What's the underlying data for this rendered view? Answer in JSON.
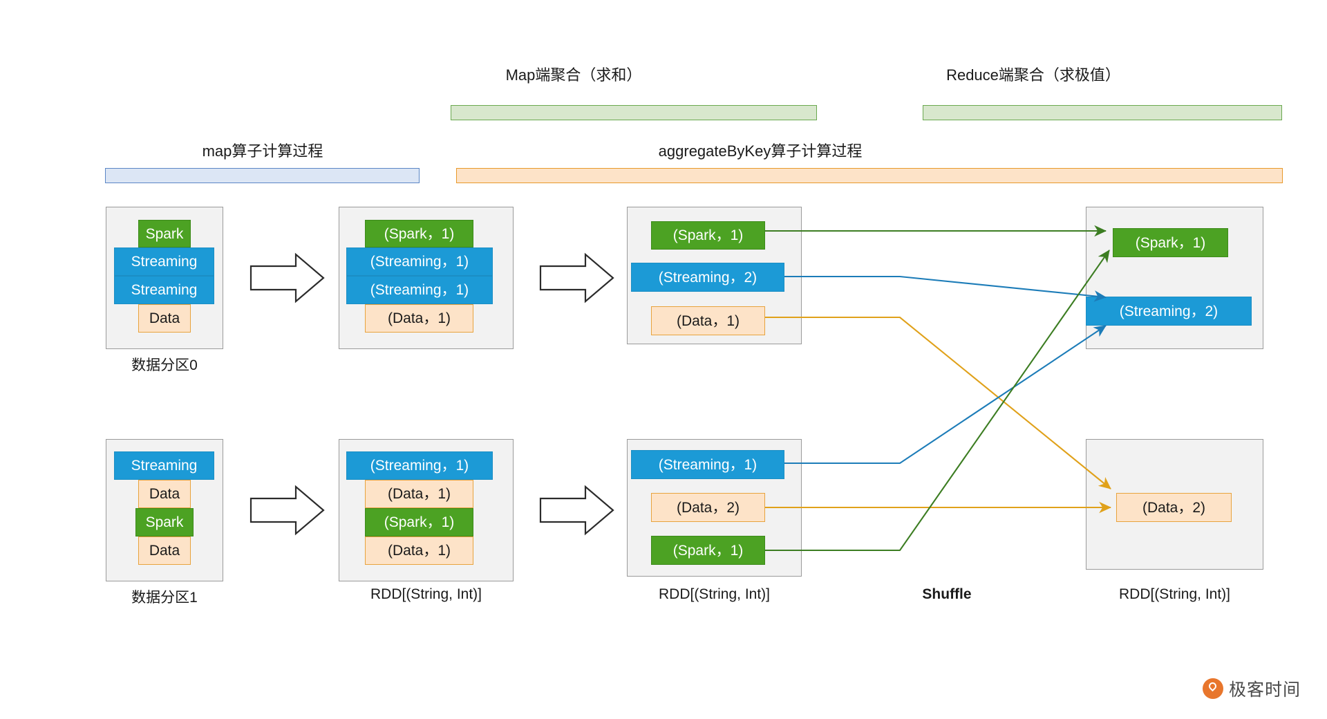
{
  "banners": [
    {
      "id": "map-agg",
      "label": "Map端聚合（求和）",
      "color": "#6aa84f",
      "fill": "#d8e7cd"
    },
    {
      "id": "reduce-agg",
      "label": "Reduce端聚合（求极值）",
      "color": "#6aa84f",
      "fill": "#d8e7cd"
    },
    {
      "id": "map-op",
      "label": "map算子计算过程",
      "color": "#5a86c5",
      "fill": "#dce6f5"
    },
    {
      "id": "aggbykey",
      "label": "aggregateByKey算子计算过程",
      "color": "#e8992a",
      "fill": "#fde3c8"
    }
  ],
  "columns": {
    "col1": {
      "caption_top": "数据分区0",
      "caption_bottom": "数据分区1",
      "partition0": [
        {
          "text": "Spark",
          "color": "green"
        },
        {
          "text": "Streaming",
          "color": "blue"
        },
        {
          "text": "Streaming",
          "color": "blue"
        },
        {
          "text": "Data",
          "color": "orange"
        }
      ],
      "partition1": [
        {
          "text": "Streaming",
          "color": "blue"
        },
        {
          "text": "Data",
          "color": "orange"
        },
        {
          "text": "Spark",
          "color": "green"
        },
        {
          "text": "Data",
          "color": "orange"
        }
      ]
    },
    "col2": {
      "caption_bottom": "RDD[(String, Int)]",
      "partition0": [
        {
          "text": "(Spark，1)",
          "color": "green"
        },
        {
          "text": "(Streaming，1)",
          "color": "blue"
        },
        {
          "text": "(Streaming，1)",
          "color": "blue"
        },
        {
          "text": "(Data，1)",
          "color": "orange"
        }
      ],
      "partition1": [
        {
          "text": "(Streaming，1)",
          "color": "blue"
        },
        {
          "text": "(Data，1)",
          "color": "orange"
        },
        {
          "text": "(Spark，1)",
          "color": "green"
        },
        {
          "text": "(Data，1)",
          "color": "orange"
        }
      ]
    },
    "col3": {
      "caption_bottom": "RDD[(String, Int)]",
      "partition0": [
        {
          "text": "(Spark，1)",
          "color": "green"
        },
        {
          "text": "(Streaming，2)",
          "color": "blue"
        },
        {
          "text": "(Data，1)",
          "color": "orange"
        }
      ],
      "partition1": [
        {
          "text": "(Streaming，1)",
          "color": "blue"
        },
        {
          "text": "(Data，2)",
          "color": "orange"
        },
        {
          "text": "(Spark，1)",
          "color": "green"
        }
      ]
    },
    "shuffle": {
      "caption_bottom": "Shuffle"
    },
    "col4": {
      "caption_bottom": "RDD[(String, Int)]",
      "partition0": [
        {
          "text": "(Spark，1)",
          "color": "green"
        },
        {
          "text": "(Streaming，2)",
          "color": "blue"
        }
      ],
      "partition1": [
        {
          "text": "(Data，2)",
          "color": "orange"
        }
      ]
    }
  },
  "arrows": {
    "block_arrow_name": "map-transform-arrow",
    "shuffle_colors": {
      "green": "#3c7d22",
      "blue": "#1c7cb8",
      "orange": "#e0a11a"
    }
  },
  "logo": {
    "wordmark": "极客时间",
    "accent": "#e8762c"
  }
}
